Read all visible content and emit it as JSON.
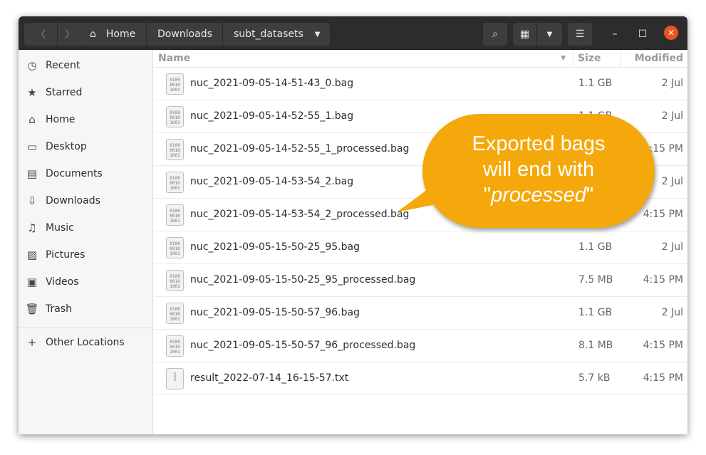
{
  "breadcrumb": [
    "Home",
    "Downloads",
    "subt_datasets"
  ],
  "sidebar": {
    "items": [
      {
        "label": "Recent",
        "icon": "clock-icon"
      },
      {
        "label": "Starred",
        "icon": "star-icon"
      },
      {
        "label": "Home",
        "icon": "home-icon"
      },
      {
        "label": "Desktop",
        "icon": "desktop-icon"
      },
      {
        "label": "Documents",
        "icon": "document-icon"
      },
      {
        "label": "Downloads",
        "icon": "download-icon"
      },
      {
        "label": "Music",
        "icon": "music-icon"
      },
      {
        "label": "Pictures",
        "icon": "picture-icon"
      },
      {
        "label": "Videos",
        "icon": "video-icon"
      },
      {
        "label": "Trash",
        "icon": "trash-icon"
      }
    ],
    "other": "Other Locations"
  },
  "columns": {
    "name": "Name",
    "size": "Size",
    "modified": "Modified"
  },
  "files": [
    {
      "name": "nuc_2021-09-05-14-51-43_0.bag",
      "size": "1.1 GB",
      "modified": "2 Jul",
      "type": "binary"
    },
    {
      "name": "nuc_2021-09-05-14-52-55_1.bag",
      "size": "1.1 GB",
      "modified": "2 Jul",
      "type": "binary"
    },
    {
      "name": "nuc_2021-09-05-14-52-55_1_processed.bag",
      "size": "",
      "modified": "4:15 PM",
      "type": "binary"
    },
    {
      "name": "nuc_2021-09-05-14-53-54_2.bag",
      "size": "",
      "modified": "2 Jul",
      "type": "binary"
    },
    {
      "name": "nuc_2021-09-05-14-53-54_2_processed.bag",
      "size": "",
      "modified": "4:15 PM",
      "type": "binary"
    },
    {
      "name": "nuc_2021-09-05-15-50-25_95.bag",
      "size": "1.1 GB",
      "modified": "2 Jul",
      "type": "binary"
    },
    {
      "name": "nuc_2021-09-05-15-50-25_95_processed.bag",
      "size": "7.5 MB",
      "modified": "4:15 PM",
      "type": "binary"
    },
    {
      "name": "nuc_2021-09-05-15-50-57_96.bag",
      "size": "1.1 GB",
      "modified": "2 Jul",
      "type": "binary"
    },
    {
      "name": "nuc_2021-09-05-15-50-57_96_processed.bag",
      "size": "8.1 MB",
      "modified": "4:15 PM",
      "type": "binary"
    },
    {
      "name": "result_2022-07-14_16-15-57.txt",
      "size": "5.7 kB",
      "modified": "4:15 PM",
      "type": "text"
    }
  ],
  "callout": {
    "line1": "Exported bags",
    "line2": "will end with",
    "quote_open": "\"",
    "emphasis": "processed",
    "quote_close": "\""
  },
  "colors": {
    "callout": "#f5a80c",
    "close": "#e95420",
    "headerbar": "#2c2c2c"
  }
}
